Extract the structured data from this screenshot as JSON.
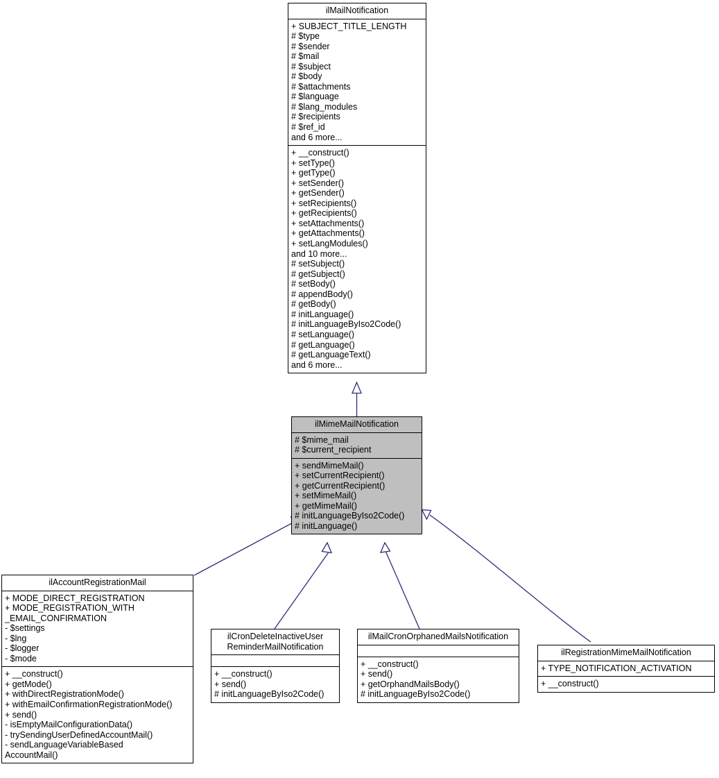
{
  "diagram": {
    "type": "uml-class-inheritance",
    "title": "ilMimeMailNotification inheritance diagram",
    "colors": {
      "edge": "#2c2c7a",
      "highlight_fill": "#bfbfbf",
      "box_fill": "#ffffff",
      "border": "#000000",
      "text": "#000000"
    }
  },
  "classes": {
    "mail_notification": {
      "name": "ilMailNotification",
      "attributes": [
        "+ SUBJECT_TITLE_LENGTH",
        "# $type",
        "# $sender",
        "# $mail",
        "# $subject",
        "# $body",
        "# $attachments",
        "# $language",
        "# $lang_modules",
        "# $recipients",
        "# $ref_id",
        "and 6 more..."
      ],
      "methods": [
        "+ __construct()",
        "+ setType()",
        "+ getType()",
        "+ setSender()",
        "+ getSender()",
        "+ setRecipients()",
        "+ getRecipients()",
        "+ setAttachments()",
        "+ getAttachments()",
        "+ setLangModules()",
        "and 10 more...",
        "# setSubject()",
        "# getSubject()",
        "# setBody()",
        "# appendBody()",
        "# getBody()",
        "# initLanguage()",
        "# initLanguageByIso2Code()",
        "# setLanguage()",
        "# getLanguage()",
        "# getLanguageText()",
        "and 6 more..."
      ]
    },
    "mime_mail_notification": {
      "name": "ilMimeMailNotification",
      "highlighted": true,
      "attributes": [
        "# $mime_mail",
        "# $current_recipient"
      ],
      "methods": [
        "+ sendMimeMail()",
        "+ setCurrentRecipient()",
        "+ getCurrentRecipient()",
        "+ setMimeMail()",
        "+ getMimeMail()",
        "# initLanguageByIso2Code()",
        "# initLanguage()"
      ]
    },
    "account_registration_mail": {
      "name": "ilAccountRegistrationMail",
      "attributes": [
        "+ MODE_DIRECT_REGISTRATION",
        "+ MODE_REGISTRATION_WITH\n_EMAIL_CONFIRMATION",
        "- $settings",
        "- $lng",
        "- $logger",
        "- $mode"
      ],
      "methods": [
        "+ __construct()",
        "+ getMode()",
        "+ withDirectRegistrationMode()",
        "+ withEmailConfirmationRegistrationMode()",
        "+ send()",
        "- isEmptyMailConfigurationData()",
        "- trySendingUserDefinedAccountMail()",
        "- sendLanguageVariableBased\nAccountMail()"
      ]
    },
    "cron_delete_inactive_user": {
      "name": "ilCronDeleteInactiveUser\nReminderMailNotification",
      "attributes": [],
      "methods": [
        "+ __construct()",
        "+ send()",
        "# initLanguageByIso2Code()"
      ]
    },
    "mail_cron_orphaned": {
      "name": "ilMailCronOrphanedMailsNotification",
      "attributes": [],
      "methods": [
        "+ __construct()",
        "+ send()",
        "+ getOrphandMailsBody()",
        "# initLanguageByIso2Code()"
      ]
    },
    "registration_mime_mail": {
      "name": "ilRegistrationMimeMailNotification",
      "attributes": [
        "+ TYPE_NOTIFICATION_ACTIVATION"
      ],
      "methods": [
        "+ __construct()"
      ]
    }
  },
  "relations": [
    {
      "from": "mime_mail_notification",
      "to": "mail_notification",
      "kind": "generalization"
    },
    {
      "from": "account_registration_mail",
      "to": "mime_mail_notification",
      "kind": "generalization"
    },
    {
      "from": "cron_delete_inactive_user",
      "to": "mime_mail_notification",
      "kind": "generalization"
    },
    {
      "from": "mail_cron_orphaned",
      "to": "mime_mail_notification",
      "kind": "generalization"
    },
    {
      "from": "registration_mime_mail",
      "to": "mime_mail_notification",
      "kind": "generalization"
    }
  ]
}
